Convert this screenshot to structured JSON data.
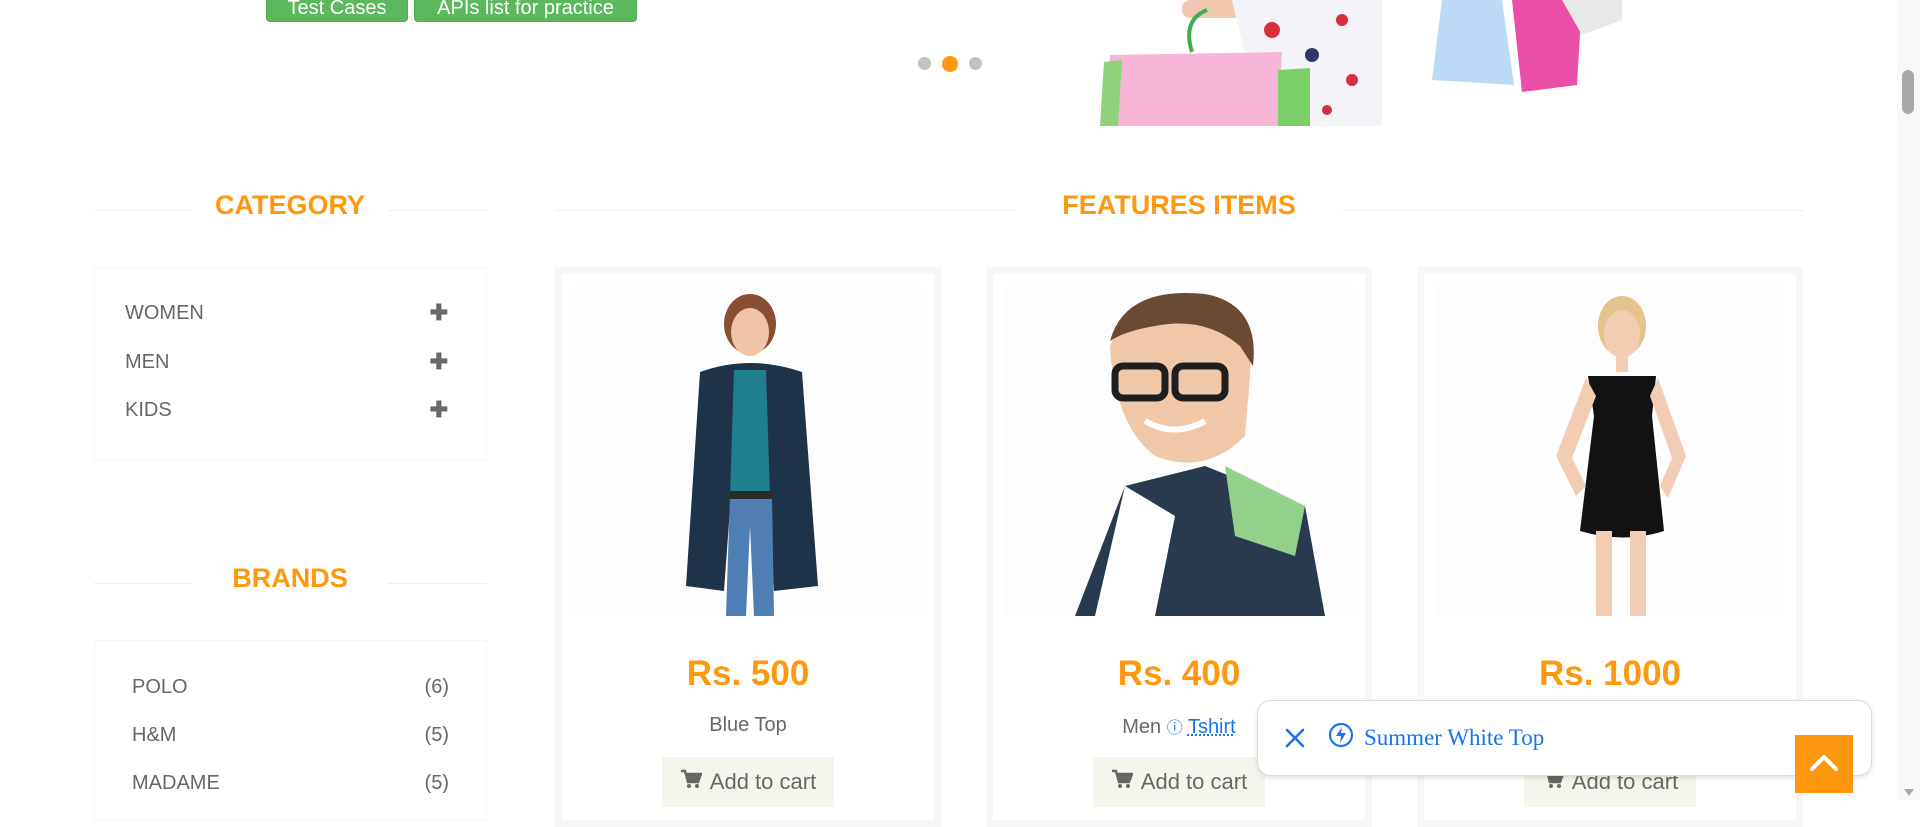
{
  "hero": {
    "buttons": [
      "Test Cases",
      "APIs list for practice"
    ],
    "slider_dots": 3,
    "active_dot": 1
  },
  "sidebar": {
    "category_title": "CATEGORY",
    "categories": [
      "WOMEN",
      "MEN",
      "KIDS"
    ],
    "brands_title": "BRANDS",
    "brands": [
      {
        "name": "POLO",
        "count": "(6)"
      },
      {
        "name": "H&M",
        "count": "(5)"
      },
      {
        "name": "MADAME",
        "count": "(5)"
      }
    ]
  },
  "features": {
    "title": "FEATURES ITEMS",
    "products": [
      {
        "price": "Rs. 500",
        "name": "Blue Top",
        "cart_label": "Add to cart"
      },
      {
        "price": "Rs. 400",
        "name_prefix": "Men",
        "name_link": "Tshirt",
        "cart_label": "Add to cart"
      },
      {
        "price": "Rs. 1000",
        "name": "",
        "cart_label": "Add to cart"
      }
    ]
  },
  "popup": {
    "text": "Summer White Top"
  },
  "colors": {
    "accent": "#fe980f",
    "green_button": "#5cb85c",
    "link_blue": "#1a73e8",
    "text_gray": "#696763"
  },
  "icons": {
    "plus": "plus-icon",
    "cart": "shopping-cart-icon",
    "close": "close-icon",
    "bolt": "lightning-bolt-icon",
    "chevron_up": "chevron-up-icon"
  }
}
